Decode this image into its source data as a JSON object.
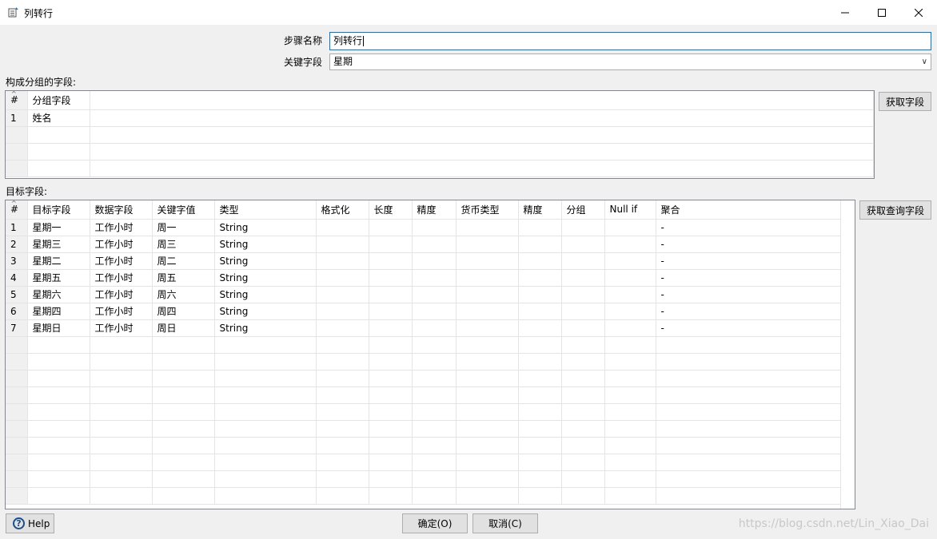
{
  "window": {
    "title": "列转行"
  },
  "form": {
    "step_name_label": "步骤名称",
    "step_name_value": "列转行",
    "key_field_label": "关键字段",
    "key_field_value": "星期"
  },
  "group_section": {
    "label": "构成分组的字段:",
    "columns": [
      "#",
      "分组字段"
    ],
    "rows": [
      [
        "1",
        "姓名"
      ]
    ],
    "get_fields_button": "获取字段"
  },
  "target_section": {
    "label": "目标字段:",
    "columns": [
      "#",
      "目标字段",
      "数据字段",
      "关键字值",
      "类型",
      "格式化",
      "长度",
      "精度",
      "货币类型",
      "精度",
      "分组",
      "Null if",
      "聚合"
    ],
    "rows": [
      [
        "1",
        "星期一",
        "工作小时",
        "周一",
        "String",
        "",
        "",
        "",
        "",
        "",
        "",
        "",
        "-"
      ],
      [
        "2",
        "星期三",
        "工作小时",
        "周三",
        "String",
        "",
        "",
        "",
        "",
        "",
        "",
        "",
        "-"
      ],
      [
        "3",
        "星期二",
        "工作小时",
        "周二",
        "String",
        "",
        "",
        "",
        "",
        "",
        "",
        "",
        "-"
      ],
      [
        "4",
        "星期五",
        "工作小时",
        "周五",
        "String",
        "",
        "",
        "",
        "",
        "",
        "",
        "",
        "-"
      ],
      [
        "5",
        "星期六",
        "工作小时",
        "周六",
        "String",
        "",
        "",
        "",
        "",
        "",
        "",
        "",
        "-"
      ],
      [
        "6",
        "星期四",
        "工作小时",
        "周四",
        "String",
        "",
        "",
        "",
        "",
        "",
        "",
        "",
        "-"
      ],
      [
        "7",
        "星期日",
        "工作小时",
        "周日",
        "String",
        "",
        "",
        "",
        "",
        "",
        "",
        "",
        "-"
      ]
    ],
    "get_lookup_fields_button": "获取查询字段"
  },
  "footer": {
    "help_label": "Help",
    "ok_label": "确定(O)",
    "cancel_label": "取消(C)",
    "watermark": "https://blog.csdn.net/Lin_Xiao_Dai"
  }
}
